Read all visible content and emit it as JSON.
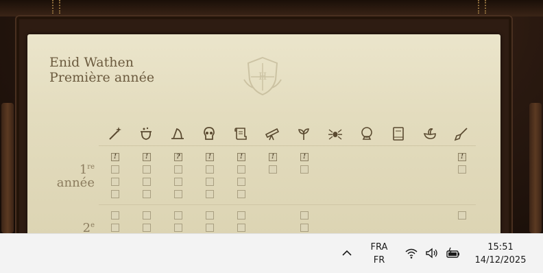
{
  "card": {
    "student_name": "Enid Wathen",
    "student_year": "Première année"
  },
  "subject_icons": [
    "wand-icon",
    "cauldron-icon",
    "witch-hat-icon",
    "skull-icon",
    "scroll-icon",
    "telescope-icon",
    "plant-icon",
    "spider-icon",
    "crystal-ball-icon",
    "book-icon",
    "bird-icon",
    "broom-icon"
  ],
  "rows": {
    "first_year": {
      "num": "1",
      "sup": "re",
      "label": "année"
    },
    "second_year": {
      "num": "2",
      "sup": "e"
    }
  },
  "marks": {
    "exclaim": "!",
    "question": "?"
  },
  "taskbar": {
    "lang_top": "FRA",
    "lang_bottom": "FR",
    "time": "15:51",
    "date": "14/12/2025"
  },
  "colors": {
    "parchment": "#e6dfc3",
    "ink": "#6b5a3e",
    "frame": "#2e1c12"
  }
}
